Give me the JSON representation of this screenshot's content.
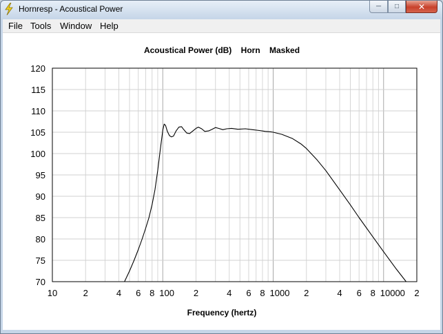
{
  "window": {
    "title": "Hornresp - Acoustical Power",
    "minimize_symbol": "─",
    "maximize_symbol": "□",
    "close_symbol": "✕"
  },
  "menu": {
    "items": [
      {
        "label": "File"
      },
      {
        "label": "Tools"
      },
      {
        "label": "Window"
      },
      {
        "label": "Help"
      }
    ]
  },
  "chart_data": {
    "type": "line",
    "title_parts": [
      "Acoustical Power (dB)",
      "Horn",
      "Masked"
    ],
    "xlabel": "Frequency (hertz)",
    "ylabel": "",
    "x_scale": "log",
    "xlim": [
      10,
      20000
    ],
    "ylim": [
      70,
      120
    ],
    "grid": true,
    "y_ticks": [
      120,
      115,
      110,
      105,
      100,
      95,
      90,
      85,
      80,
      75,
      70
    ],
    "x_tick_labels": [
      {
        "x": 10,
        "label": "10"
      },
      {
        "x": 20,
        "label": "2"
      },
      {
        "x": 40,
        "label": "4"
      },
      {
        "x": 60,
        "label": "6"
      },
      {
        "x": 80,
        "label": "8"
      },
      {
        "x": 100,
        "label": "100"
      },
      {
        "x": 200,
        "label": "2"
      },
      {
        "x": 400,
        "label": "4"
      },
      {
        "x": 600,
        "label": "6"
      },
      {
        "x": 800,
        "label": "8"
      },
      {
        "x": 1000,
        "label": "1000"
      },
      {
        "x": 2000,
        "label": "2"
      },
      {
        "x": 4000,
        "label": "4"
      },
      {
        "x": 6000,
        "label": "6"
      },
      {
        "x": 8000,
        "label": "8"
      },
      {
        "x": 10000,
        "label": "10000"
      },
      {
        "x": 20000,
        "label": "2"
      }
    ],
    "series": [
      {
        "line_color": "#000000",
        "points": [
          [
            45,
            70
          ],
          [
            50,
            72.5
          ],
          [
            55,
            75
          ],
          [
            60,
            77.5
          ],
          [
            65,
            80
          ],
          [
            70,
            82.5
          ],
          [
            75,
            85
          ],
          [
            80,
            88
          ],
          [
            85,
            91.5
          ],
          [
            90,
            96
          ],
          [
            95,
            101
          ],
          [
            100,
            105.5
          ],
          [
            103,
            106.9
          ],
          [
            106,
            106.6
          ],
          [
            110,
            105.2
          ],
          [
            115,
            104.2
          ],
          [
            120,
            103.9
          ],
          [
            125,
            104.1
          ],
          [
            132,
            105.3
          ],
          [
            140,
            106.2
          ],
          [
            148,
            106.3
          ],
          [
            155,
            105.6
          ],
          [
            165,
            104.8
          ],
          [
            175,
            104.7
          ],
          [
            185,
            105.2
          ],
          [
            200,
            105.9
          ],
          [
            210,
            106.2
          ],
          [
            225,
            105.8
          ],
          [
            240,
            105.2
          ],
          [
            260,
            105.3
          ],
          [
            280,
            105.7
          ],
          [
            300,
            106.1
          ],
          [
            320,
            105.9
          ],
          [
            350,
            105.6
          ],
          [
            380,
            105.8
          ],
          [
            420,
            105.9
          ],
          [
            480,
            105.7
          ],
          [
            560,
            105.8
          ],
          [
            650,
            105.6
          ],
          [
            750,
            105.4
          ],
          [
            850,
            105.2
          ],
          [
            950,
            105.1
          ],
          [
            1000,
            105.0
          ],
          [
            1200,
            104.5
          ],
          [
            1500,
            103.5
          ],
          [
            1800,
            102.2
          ],
          [
            2000,
            101.2
          ],
          [
            2500,
            98.5
          ],
          [
            3000,
            96
          ],
          [
            4000,
            91.5
          ],
          [
            5000,
            88
          ],
          [
            6000,
            85
          ],
          [
            8000,
            80.5
          ],
          [
            10000,
            77
          ],
          [
            13000,
            73
          ],
          [
            16000,
            70
          ]
        ]
      }
    ]
  }
}
